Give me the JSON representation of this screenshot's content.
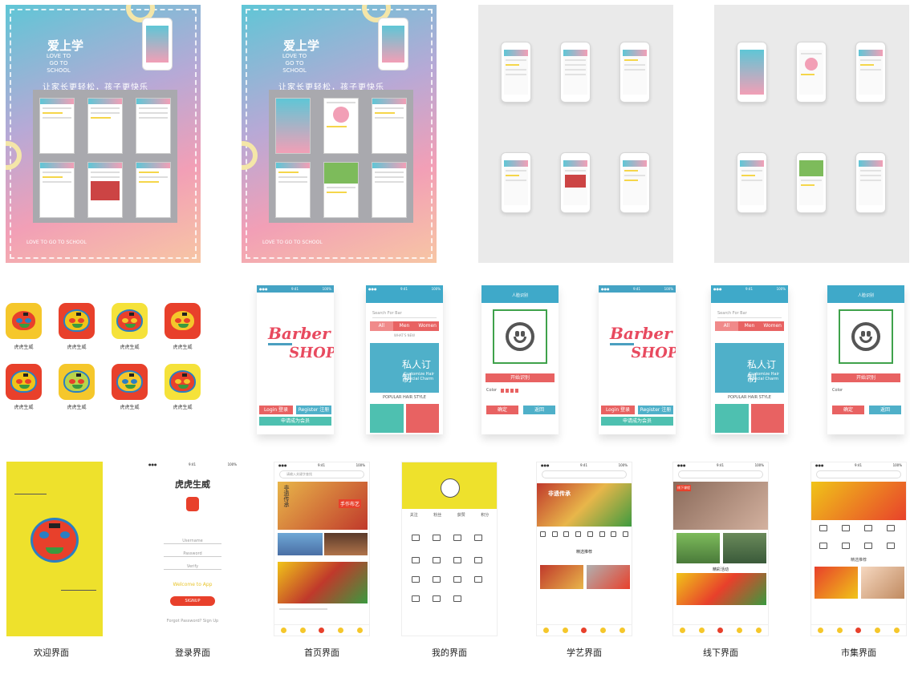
{
  "posters": [
    {
      "title": "爱上学",
      "en_lines": [
        "LOVE TO",
        "GO TO",
        "SCHOOL"
      ],
      "slogan": "让家长更轻松，孩子更快乐",
      "footer": "LOVE TO GO TO SCHOOL"
    },
    {
      "title": "爱上学",
      "en_lines": [
        "LOVE TO",
        "GO TO",
        "SCHOOL"
      ],
      "slogan": "让家长更轻松，孩子更快乐",
      "footer": "LOVE TO GO TO SCHOOL"
    }
  ],
  "tiger_label": "虎虎生威",
  "barber": {
    "logo_top": "Barber",
    "logo_bottom": "SHOP",
    "login": "Login 登录",
    "register": "Register 注册",
    "member": "申请成为会员",
    "search_placeholder": "Search For Bar",
    "tabs": [
      "All",
      "Men",
      "Women"
    ],
    "whats_new": "WHAT'S NEW",
    "banner_zh": "私人订制",
    "banner_en": "Customize Hair Special Charm",
    "popular": "POPULAR HAIR STYLE",
    "face_title": "人脸识别",
    "face_btn": "开始识别",
    "color_label": "Color",
    "btn_left": "确定",
    "btn_right": "返回"
  },
  "screens": [
    {
      "caption": "欢迎界面"
    },
    {
      "caption": "登录界面",
      "brand": "虎虎生威",
      "fields": [
        "Username",
        "Password",
        "Verify"
      ],
      "welcome": "Welcome to App",
      "button": "SIGNUP",
      "footer": "Forgot Password? Sign Up"
    },
    {
      "caption": "首页界面",
      "search": "请输入关键字查找",
      "banner_side": "非遗传承",
      "banner_tag": "手作布艺"
    },
    {
      "caption": "我的界面",
      "stats": [
        "关注",
        "粉丝",
        "获赞",
        "积分"
      ]
    },
    {
      "caption": "学艺界面",
      "banner": "非遗传承",
      "section": "精选推荐"
    },
    {
      "caption": "线下界面",
      "tag": "线下课程",
      "section": "精彩活动"
    },
    {
      "caption": "市集界面",
      "section": "精选推荐"
    }
  ],
  "colors": {
    "yellow": "#eee12c",
    "teal": "#44a3c4",
    "coral": "#e86262",
    "pink": "#f29fb6"
  }
}
